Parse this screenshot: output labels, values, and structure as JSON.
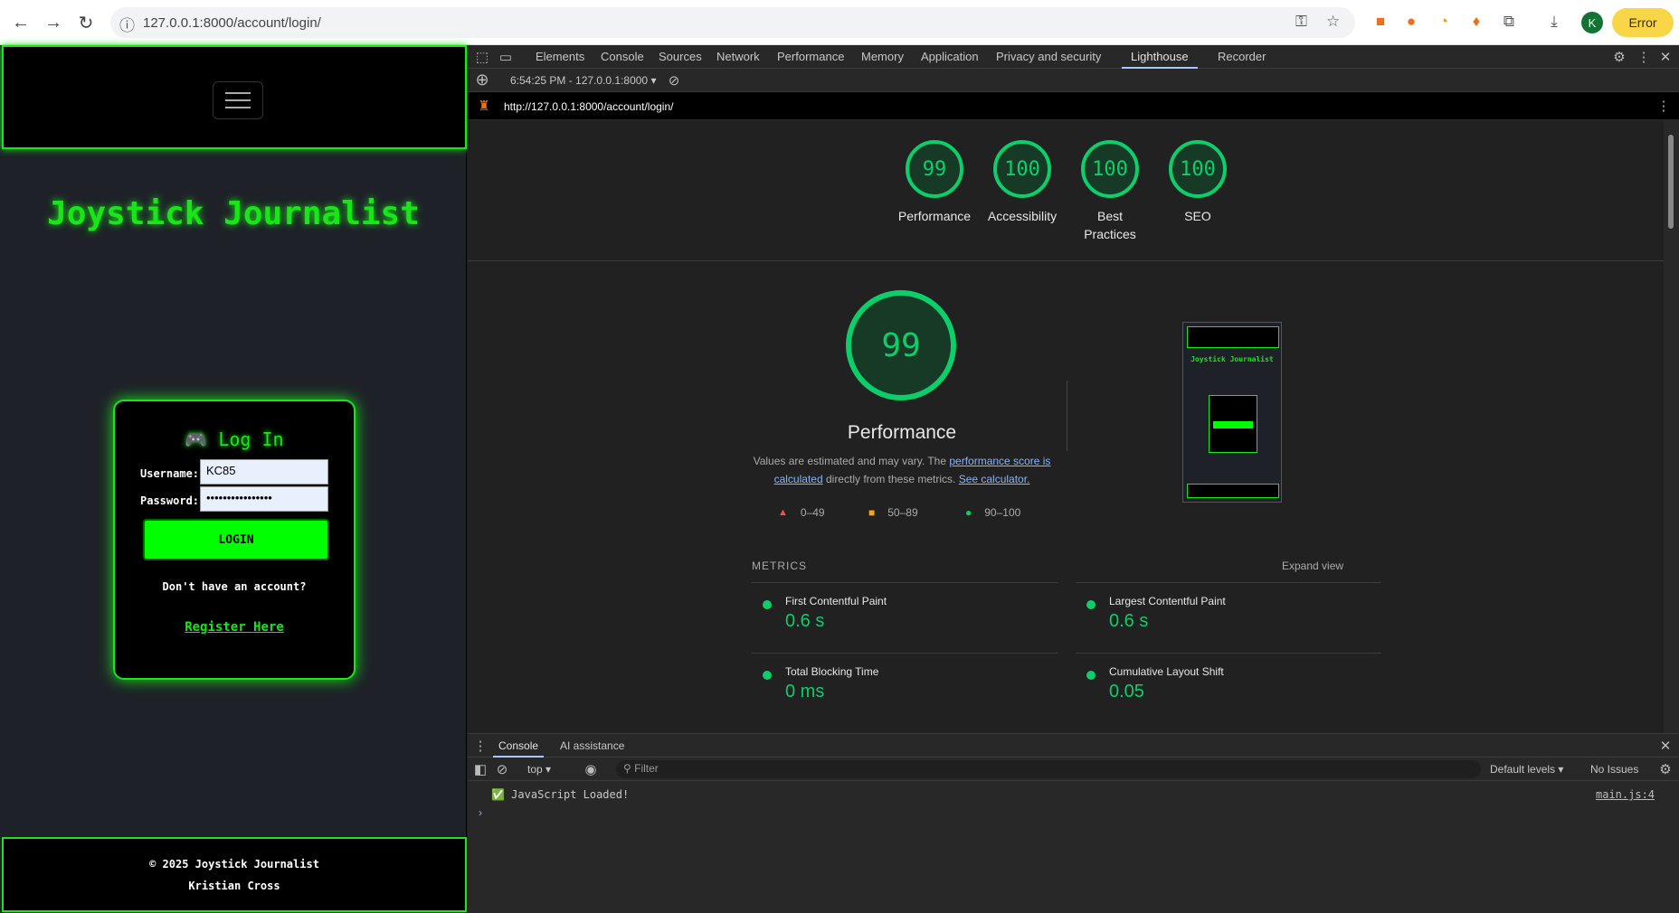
{
  "browser": {
    "url": "127.0.0.1:8000/account/login/",
    "profile_initial": "K",
    "error_label": "Error"
  },
  "page": {
    "site_title": "Joystick Journalist",
    "login_title": "🎮 Log In",
    "username_label": "Username:",
    "username_value": "KC85",
    "password_label": "Password:",
    "password_value": "••••••••••••••••",
    "login_button": "LOGIN",
    "no_account_text": "Don't have an account?",
    "register_link": "Register Here",
    "footer_line1": "© 2025 Joystick Journalist",
    "footer_line2": "Kristian Cross"
  },
  "devtools": {
    "tabs": [
      "Elements",
      "Console",
      "Sources",
      "Network",
      "Performance",
      "Memory",
      "Application",
      "Privacy and security",
      "Lighthouse",
      "Recorder"
    ],
    "active_tab": "Lighthouse",
    "report_selector": "6:54:25 PM - 127.0.0.1:8000",
    "report_url": "http://127.0.0.1:8000/account/login/",
    "scores": [
      {
        "label": "Performance",
        "value": "99"
      },
      {
        "label": "Accessibility",
        "value": "100"
      },
      {
        "label": "Best Practices",
        "value": "100"
      },
      {
        "label": "SEO",
        "value": "100"
      }
    ],
    "performance_score": "99",
    "performance_title": "Performance",
    "desc_prefix": "Values are estimated and may vary. The ",
    "desc_link1": "performance score is calculated",
    "desc_middle": " directly from these metrics. ",
    "desc_link2": "See calculator.",
    "legend": [
      "0–49",
      "50–89",
      "90–100"
    ],
    "metrics_heading": "METRICS",
    "expand_view": "Expand view",
    "metrics": [
      {
        "name": "First Contentful Paint",
        "value": "0.6 s"
      },
      {
        "name": "Largest Contentful Paint",
        "value": "0.6 s"
      },
      {
        "name": "Total Blocking Time",
        "value": "0 ms"
      },
      {
        "name": "Cumulative Layout Shift",
        "value": "0.05"
      }
    ],
    "drawer_tabs": [
      "Console",
      "AI assistance"
    ],
    "context": "top",
    "filter_placeholder": "Filter",
    "default_levels": "Default levels",
    "issues": "No Issues",
    "console_message": "✅ JavaScript Loaded!",
    "console_source": "main.js:4"
  },
  "colors": {
    "accent_green": "#19e619",
    "score_green": "#0cce6b"
  }
}
